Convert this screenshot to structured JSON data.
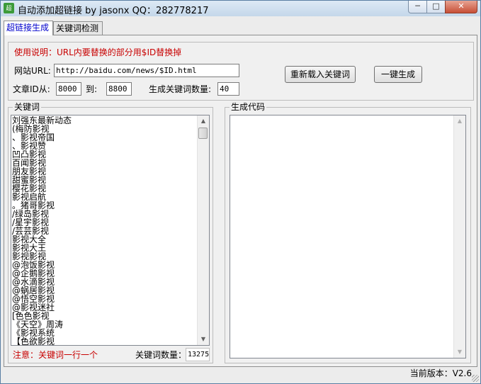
{
  "window": {
    "title": "自动添加超链接 by jasonx QQ：282778217",
    "app_icon_text": "超",
    "minimize_glyph": "─",
    "maximize_glyph": "□",
    "close_glyph": "✕"
  },
  "tabs": [
    {
      "label": "超链接生成",
      "active": true
    },
    {
      "label": "关键词检测",
      "active": false
    }
  ],
  "settings": {
    "usage_note": "使用说明：URL内要替换的部分用$ID替换掉",
    "url_label": "网站URL:",
    "url_value": "http://baidu.com/news/$ID.html",
    "article_id_from_label": "文章ID从:",
    "article_id_from_value": "8000",
    "article_id_to_label": "到:",
    "article_id_to_value": "8800",
    "keyword_count_label": "生成关键词数量:",
    "keyword_count_value": "40",
    "reload_button": "重新载入关键词",
    "generate_button": "一键生成"
  },
  "keywords_panel": {
    "title": "关键词",
    "items": [
      "刘强东最新动态",
      "(梅防影视",
      "、影视帝国",
      "、影视赞",
      "凹凸影视",
      "百闻影视",
      "朋友影视",
      "甜蜜影视",
      "樱花影视",
      "影视启航",
      "。猪哥影视",
      "/绿岛影视",
      "/星宇影视",
      "/芸芸影视",
      "影视大全",
      "影视大王",
      "影视影视",
      "@泡饭影视",
      "@企鹅影视",
      "@水滴影视",
      "@蜗居影视",
      "@悟空影视",
      "@影视迷社",
      "[色色影视",
      "《天空》周涛",
      "《影视系统",
      "【色欲影视"
    ],
    "note": "注意：关键词一行一个",
    "count_label": "关键词数量：",
    "count_value": "13275"
  },
  "output_panel": {
    "title": "生成代码",
    "content": ""
  },
  "status": {
    "version": "当前版本：V2.6"
  },
  "colors": {
    "accent_red": "#c80000",
    "tab_active_text": "#0000cc"
  }
}
